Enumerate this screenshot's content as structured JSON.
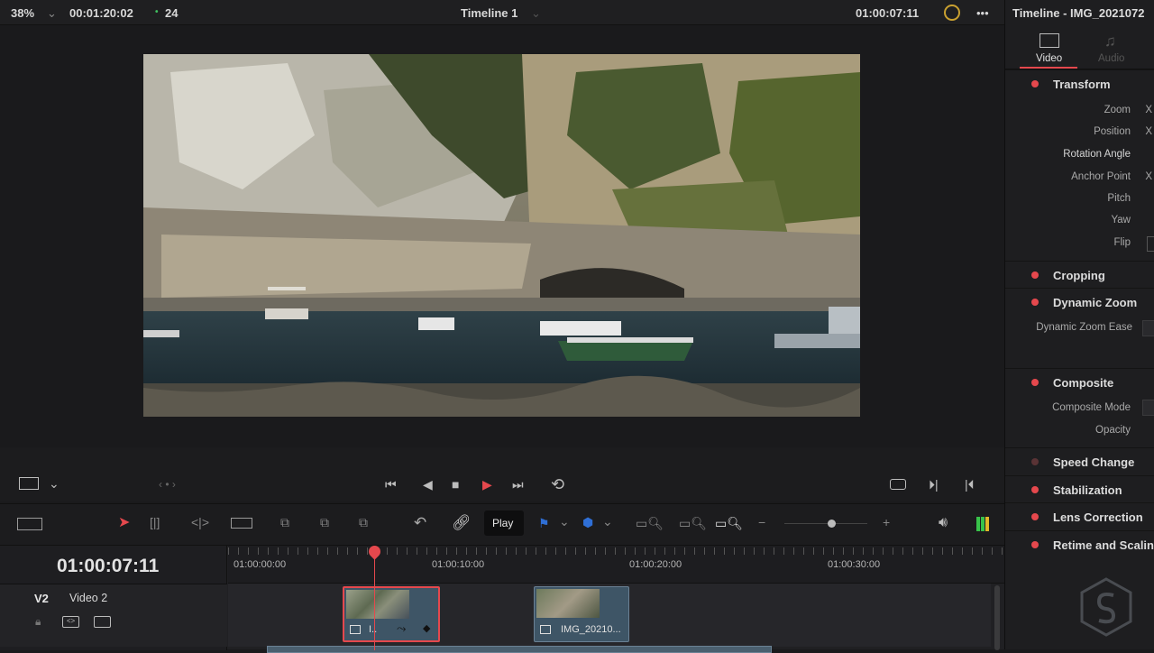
{
  "topbar": {
    "zoom": "38%",
    "source_timecode": "00:01:20:02",
    "clip_count": "24",
    "timeline_name": "Timeline 1",
    "record_timecode": "01:00:07:11"
  },
  "inspector": {
    "title": "Timeline - IMG_2021072",
    "tabs": [
      {
        "label": "Video",
        "icon": "film-icon",
        "active": true
      },
      {
        "label": "Audio",
        "icon": "music-note-icon",
        "active": false
      }
    ],
    "transform": {
      "label": "Transform",
      "fields": [
        "Zoom",
        "Position",
        "Rotation Angle",
        "Anchor Point",
        "Pitch",
        "Yaw",
        "Flip"
      ],
      "x_label": "X"
    },
    "sections": {
      "cropping": "Cropping",
      "dynamic_zoom": "Dynamic Zoom",
      "dynamic_zoom_ease": "Dynamic Zoom Ease",
      "composite": "Composite",
      "composite_mode": "Composite Mode",
      "opacity": "Opacity",
      "speed_change": "Speed Change",
      "stabilization": "Stabilization",
      "lens_correction": "Lens Correction",
      "retime_scaling": "Retime and Scaling"
    }
  },
  "toolbar": {
    "play_tooltip": "Play"
  },
  "timeline": {
    "current_timecode": "01:00:07:11",
    "ruler": [
      "01:00:00:00",
      "01:00:10:00",
      "01:00:20:00",
      "01:00:30:00"
    ],
    "track": {
      "id": "V2",
      "name": "Video 2"
    },
    "clips": [
      {
        "label": "I..",
        "selected": true
      },
      {
        "label": "IMG_20210...",
        "selected": false
      }
    ]
  },
  "colors": {
    "accent_red": "#e5484d",
    "playhead": "#e5484d",
    "clip_blue": "#3e5566"
  }
}
